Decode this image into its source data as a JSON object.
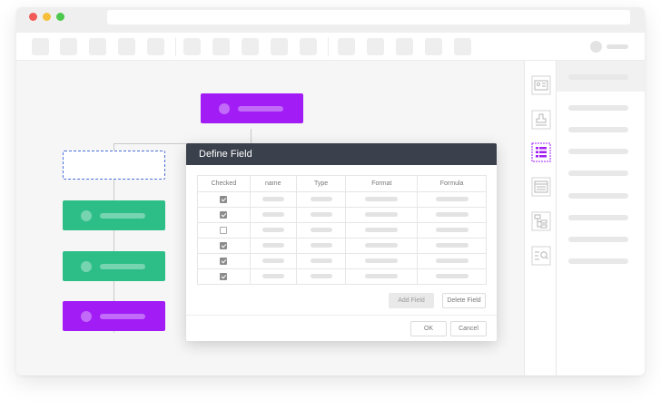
{
  "colors": {
    "purple_node": "#a11cf5",
    "green_node": "#2dbe88",
    "dialog_header": "#3a404c",
    "traffic_red": "#f25a5a",
    "traffic_yellow": "#f5bf3b",
    "traffic_green": "#4cc84c"
  },
  "window": {
    "traffic_lights": [
      "close",
      "minimize",
      "maximize"
    ]
  },
  "icon_strip": {
    "icons": [
      "contact-card-icon",
      "stamp-icon",
      "table-fields-icon",
      "form-layout-icon",
      "hierarchy-icon",
      "search-list-icon"
    ],
    "active": "table-fields-icon"
  },
  "dialog": {
    "title": "Define Field",
    "columns": [
      "Checked",
      "name",
      "Type",
      "Format",
      "Formula"
    ],
    "rows": [
      {
        "checked": true
      },
      {
        "checked": true
      },
      {
        "checked": false
      },
      {
        "checked": true
      },
      {
        "checked": true
      },
      {
        "checked": true
      }
    ],
    "add_field_label": "Add Field",
    "delete_field_label": "Delete Field",
    "ok_label": "OK",
    "cancel_label": "Cancel"
  }
}
